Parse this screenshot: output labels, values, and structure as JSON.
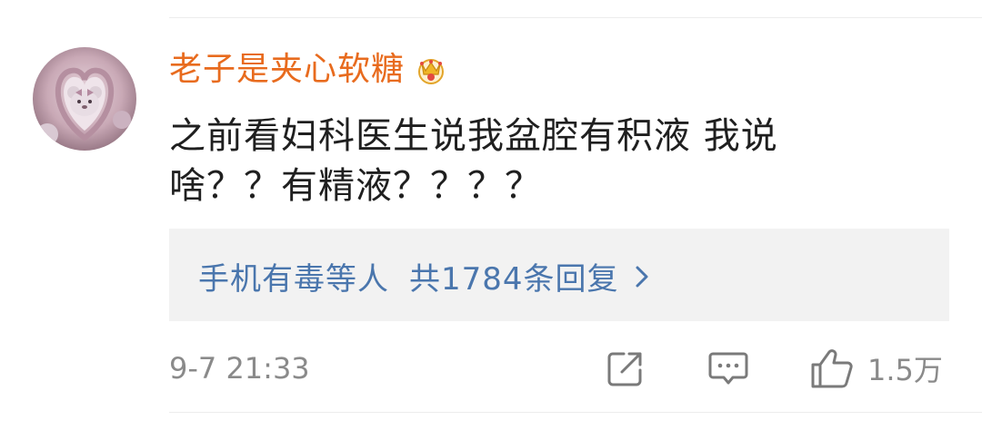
{
  "comment": {
    "username": "老子是夹心软糖",
    "text": "之前看妇科医生说我盆腔有积液 我说\n啥？？有精液？？？？",
    "timestamp": "9-7 21:33"
  },
  "replies": {
    "users": "手机有毒等人",
    "count_label": "共1784条回复"
  },
  "actions": {
    "like_count": "1.5万"
  },
  "colors": {
    "username": "#e86b1e",
    "link": "#4a76ad",
    "meta": "#8a8a8a"
  }
}
